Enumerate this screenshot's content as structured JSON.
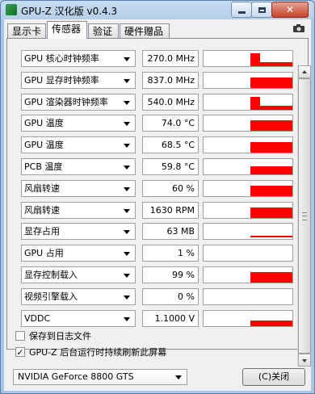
{
  "window": {
    "title": "GPU-Z 汉化版 v0.4.3",
    "accent": "#ff0000"
  },
  "tabs": [
    {
      "label": "显示卡",
      "active": false
    },
    {
      "label": "传感器",
      "active": true
    },
    {
      "label": "验证",
      "active": false
    },
    {
      "label": "硬件赠品",
      "active": false
    }
  ],
  "toolbar": {
    "screenshot_icon": "camera-icon"
  },
  "sensors": [
    {
      "name": "GPU 核心时钟频率",
      "value": "270.0 MHz",
      "graph": "step"
    },
    {
      "name": "GPU 显存时钟频率",
      "value": "837.0 MHz",
      "graph": "full"
    },
    {
      "name": "GPU 渲染器时钟频率",
      "value": "540.0 MHz",
      "graph": "step"
    },
    {
      "name": "GPU 温度",
      "value": "74.0 °C",
      "graph": "full"
    },
    {
      "name": "GPU 温度",
      "value": "68.5 °C",
      "graph": "full"
    },
    {
      "name": "PCB 温度",
      "value": "59.8 °C",
      "graph": "partial"
    },
    {
      "name": "风扇转速",
      "value": "60 %",
      "graph": "full"
    },
    {
      "name": "风扇转速",
      "value": "1630 RPM",
      "graph": "full"
    },
    {
      "name": "显存占用",
      "value": "63 MB",
      "graph": "line"
    },
    {
      "name": "GPU 占用",
      "value": "1 %",
      "graph": "none"
    },
    {
      "name": "显存控制载入",
      "value": "99 %",
      "graph": "full"
    },
    {
      "name": "视频引擎载入",
      "value": "0 %",
      "graph": "none"
    },
    {
      "name": "VDDC",
      "value": "1.1000 V",
      "graph": "low"
    }
  ],
  "options": {
    "log_to_file": {
      "label": "保存到日志文件",
      "checked": false
    },
    "background_refresh": {
      "label": "GPU-Z 后台运行时持续刷新此屏幕",
      "checked": true
    }
  },
  "footer": {
    "gpu_selected": "NVIDIA GeForce 8800 GTS",
    "close_label": "(C)关闭"
  }
}
